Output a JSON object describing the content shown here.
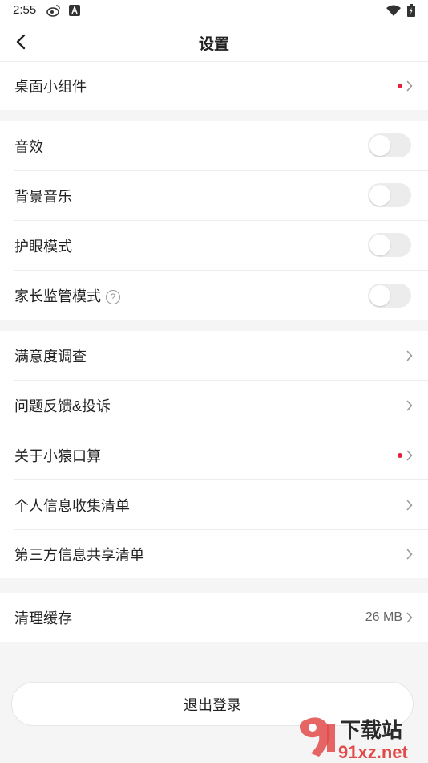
{
  "status_bar": {
    "time": "2:55",
    "left_icons": [
      "weibo-icon",
      "app-a-icon"
    ],
    "right_icons": [
      "wifi-icon",
      "battery-icon"
    ]
  },
  "header": {
    "title": "设置",
    "back_icon": "chevron-left-icon"
  },
  "groups": {
    "widget": {
      "label": "桌面小组件",
      "has_red_dot": true
    },
    "toggles": [
      {
        "label": "音效",
        "on": false
      },
      {
        "label": "背景音乐",
        "on": false
      },
      {
        "label": "护眼模式",
        "on": false
      },
      {
        "label": "家长监管模式",
        "on": false,
        "help_icon": "?"
      }
    ],
    "links": [
      {
        "label": "满意度调查",
        "has_red_dot": false
      },
      {
        "label": "问题反馈&投诉",
        "has_red_dot": false
      },
      {
        "label": "关于小猿口算",
        "has_red_dot": true
      },
      {
        "label": "个人信息收集清单",
        "has_red_dot": false
      },
      {
        "label": "第三方信息共享清单",
        "has_red_dot": false
      }
    ],
    "cache": {
      "label": "清理缓存",
      "value": "26 MB"
    }
  },
  "logout": {
    "label": "退出登录"
  },
  "watermark": {
    "text_top": "下载站",
    "text_bottom": "91xz.net"
  },
  "colors": {
    "accent_red": "#e8213a",
    "toggle_off": "#ececec"
  }
}
